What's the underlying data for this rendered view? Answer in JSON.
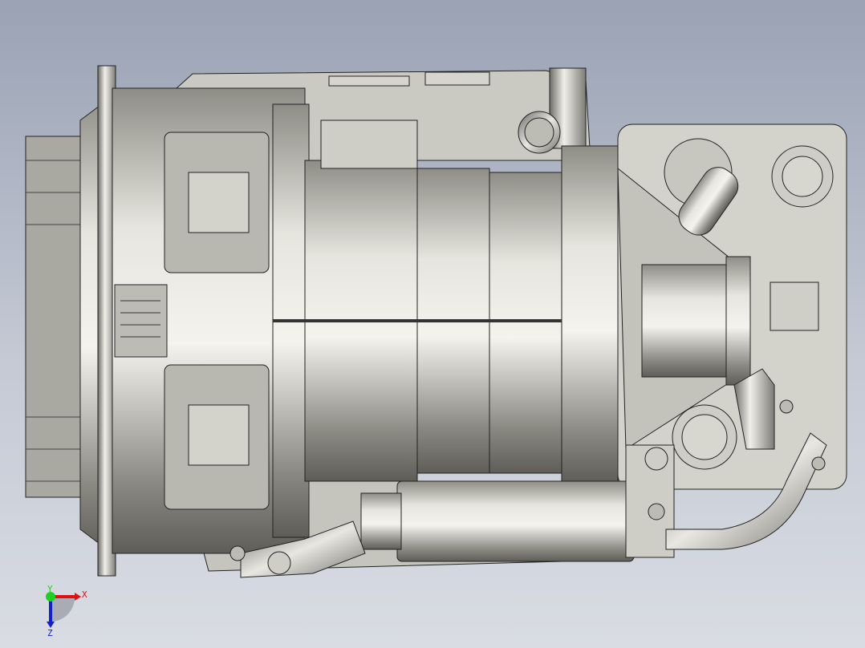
{
  "triad": {
    "x_label": "X",
    "y_label": "Y",
    "z_label": "Z"
  },
  "colors": {
    "background_top": "#9aa2b4",
    "background_bottom": "#d9dce3",
    "model": "#c9c8bf",
    "x_axis": "#e01010",
    "y_axis": "#20d020",
    "z_axis": "#1020d0"
  }
}
